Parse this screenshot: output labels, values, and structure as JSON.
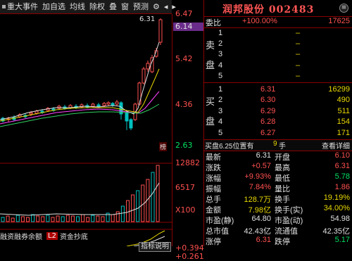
{
  "toolbar": {
    "items": [
      "重大事件",
      "加自选",
      "均线",
      "除权",
      "叠",
      "窗",
      "预测"
    ],
    "icons": [
      "gear-icon",
      "arrow-left-icon",
      "arrow-right-icon"
    ]
  },
  "price_axis": [
    "6.47",
    "6.14",
    "5.42",
    "4.36",
    "2.63"
  ],
  "overlay": {
    "high_label": "6.31",
    "corner_label": "榜"
  },
  "volume_axis": [
    "12882",
    "6517",
    "X100"
  ],
  "bottom_tabs": [
    "融资融券余额",
    "L2",
    "资金抄底"
  ],
  "indicator_button": "指标说明",
  "indicator_values": [
    "+0.394",
    "+0.261"
  ],
  "header": {
    "name": "润邦股份",
    "code": "002483"
  },
  "weibi": {
    "label": "委比",
    "value": "+100.00%",
    "volume": "17625"
  },
  "sell": {
    "label": "卖盘",
    "levels": [
      {
        "n": "5",
        "p": "",
        "v": "–"
      },
      {
        "n": "4",
        "p": "",
        "v": "–"
      },
      {
        "n": "3",
        "p": "",
        "v": "–"
      },
      {
        "n": "2",
        "p": "",
        "v": "–"
      },
      {
        "n": "1",
        "p": "",
        "v": "–"
      }
    ]
  },
  "buy": {
    "label": "买盘",
    "levels": [
      {
        "n": "1",
        "p": "6.31",
        "v": "16299"
      },
      {
        "n": "2",
        "p": "6.30",
        "v": "490"
      },
      {
        "n": "3",
        "p": "6.29",
        "v": "511"
      },
      {
        "n": "4",
        "p": "6.28",
        "v": "154"
      },
      {
        "n": "5",
        "p": "6.27",
        "v": "171"
      }
    ]
  },
  "info_bar": {
    "text": "买盘6.25位置有",
    "num": "9",
    "suffix": "手",
    "link": "查看详细"
  },
  "stats": [
    [
      "最新",
      "6.31",
      "开盘",
      "6.10"
    ],
    [
      "涨跌",
      "+0.57",
      "最高",
      "6.31"
    ],
    [
      "涨幅",
      "+9.93%",
      "最低",
      "5.78"
    ],
    [
      "振幅",
      "7.84%",
      "量比",
      "1.86"
    ],
    [
      "总手",
      "128.7万",
      "换手",
      "19.19%"
    ],
    [
      "金额",
      "7.98亿",
      "换手(实)",
      "34.00%"
    ],
    [
      "市盈(静)",
      "64.80",
      "市盈(动)",
      "54.98"
    ],
    [
      "总市值",
      "42.43亿",
      "流通值",
      "42.35亿"
    ],
    [
      "涨停",
      "6.31",
      "跌停",
      "5.17"
    ]
  ],
  "colors": {
    "up": "#ff5050",
    "down": "#00e060",
    "accent": "#8a0000",
    "highlight": "#6a2c8a"
  }
}
